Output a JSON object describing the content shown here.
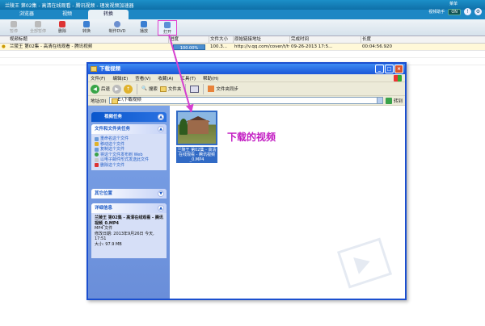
{
  "app": {
    "title": "兰陵王 第02集 - 高清在线观看 - 腾讯视频 - 理发视频加速器",
    "menu_label": "菜单",
    "toggle_label": "视频助手",
    "toggle_state": "ON"
  },
  "tabs": [
    {
      "label": "浏览器"
    },
    {
      "label": "视频"
    },
    {
      "label": "转换"
    }
  ],
  "toolbar": {
    "pause": "暂停",
    "pause_all": "全部暂停",
    "delete": "删除",
    "convert": "转换",
    "make_dvd": "制作DVD",
    "play": "播放",
    "open": "打开"
  },
  "table": {
    "headers": [
      "视频标题",
      "进度",
      "文件大小",
      "原始链接地址",
      "完成时间",
      "长度"
    ],
    "row": {
      "title": "兰陵王 第02集 - 高清在线观看 - 腾讯视频",
      "progress": "100.00%",
      "progress_fraction": 1,
      "size": "100.3...",
      "url": "http://v.qq.com/cover/t/twt6a...",
      "done": "09-26-2013 17:5...",
      "length": "00:04:56.920"
    }
  },
  "explorer": {
    "title": "下载视频",
    "menu": [
      "文件(F)",
      "编辑(E)",
      "查看(V)",
      "收藏(A)",
      "工具(T)",
      "帮助(H)"
    ],
    "toolbar": {
      "back": "后退",
      "search": "搜索",
      "folders": "文件夹",
      "sync": "文件夹同步"
    },
    "address_label": "地址(D)",
    "address": "E:\\下载视频",
    "go": "转到",
    "panel_video_tasks": "视频任务",
    "panel_file_tasks": "文件和文件夹任务",
    "tasks": [
      "重命名这个文件",
      "移动这个文件",
      "复制这个文件",
      "将这个文件发布到 Web",
      "以电子邮件形式发送此文件",
      "删除这个文件"
    ],
    "panel_other": "其它位置",
    "panel_details": "详细信息",
    "details": {
      "name": "兰陵王 第02集 - 高清在线观看 - 腾讯视频_0.MP4",
      "type": "MP4 文件",
      "modified": "修改日期: 2013年9月26日 今天, 17:51",
      "size": "大小: 97.9 MB"
    },
    "file_caption": "兰陵王 第02集 - 高清在线观看 - 腾讯视频_0.MP4"
  },
  "annotation": "下载的视频",
  "colors": {
    "accent": "#1d87c4",
    "highlight": "#e23fce",
    "xp_title": "#1a56d8",
    "note": "#c21bc2"
  }
}
